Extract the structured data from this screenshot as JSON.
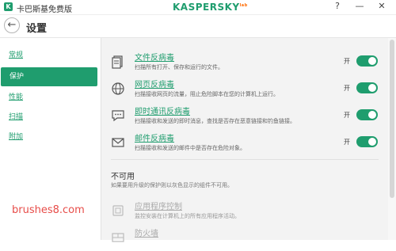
{
  "window": {
    "title": "卡巴斯基免费版",
    "brand": "KASPERSKY",
    "brand_mark": "lab",
    "help": "?",
    "minimize": "—",
    "close": "✕"
  },
  "header": {
    "back": "←",
    "title": "设置"
  },
  "sidebar": {
    "items": [
      {
        "label": "常规",
        "active": false
      },
      {
        "label": "保护",
        "active": true
      },
      {
        "label": "性能",
        "active": false
      },
      {
        "label": "扫描",
        "active": false
      },
      {
        "label": "附加",
        "active": false
      }
    ]
  },
  "main": {
    "components": [
      {
        "icon": "file-icon",
        "title": "文件反病毒",
        "desc": "扫描所有打开、保存和运行的文件。",
        "toggle_label": "开",
        "enabled": true
      },
      {
        "icon": "globe-icon",
        "title": "网页反病毒",
        "desc": "扫描接收网页的流量，阻止危险脚本在您的计算机上运行。",
        "toggle_label": "开",
        "enabled": true
      },
      {
        "icon": "chat-icon",
        "title": "即时通讯反病毒",
        "desc": "扫描接收和发送的即时消息，查找是否存在恶意链接和钓鱼链接。",
        "toggle_label": "开",
        "enabled": true
      },
      {
        "icon": "mail-icon",
        "title": "邮件反病毒",
        "desc": "扫描接收和发送的邮件中是否存在危险对象。",
        "toggle_label": "开",
        "enabled": true
      }
    ],
    "unavailable": {
      "title": "不可用",
      "desc": "如果要用升级的保护则以灰色显示的组件不可用。",
      "items": [
        {
          "icon": "app-control-icon",
          "title": "应用程序控制",
          "desc": "监控安装在计算机上的所有应用程序活动。"
        },
        {
          "icon": "firewall-icon",
          "title": "防火墙",
          "desc": ""
        }
      ]
    }
  },
  "watermark": "brushes8.com",
  "colors": {
    "accent": "#1f9d6e",
    "background": "#f3f3f3"
  }
}
